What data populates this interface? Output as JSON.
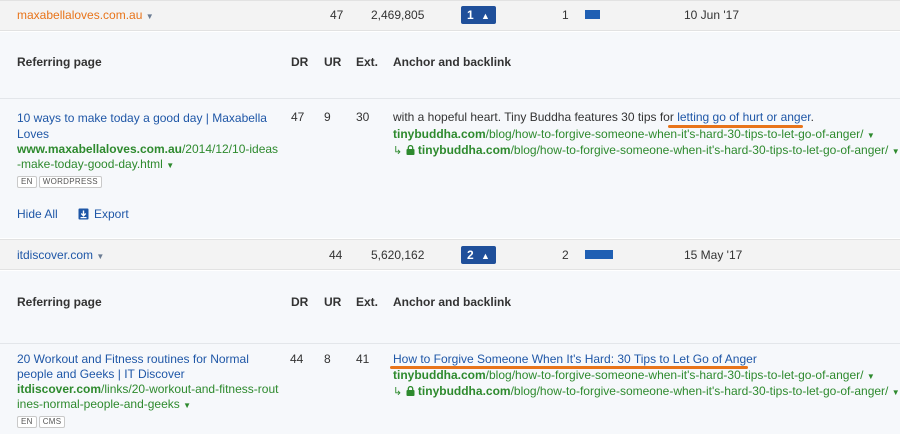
{
  "columns": {
    "referring_page": "Referring page",
    "dr": "DR",
    "ur": "UR",
    "ext": "Ext.",
    "anchor": "Anchor and backlink"
  },
  "groups": [
    {
      "domain": "maxabellaloves.com.au",
      "dr": "47",
      "refdomains": "2,469,805",
      "links": "1",
      "count": "1",
      "date": "10 Jun '17",
      "bar_fraction": 0.3,
      "row": {
        "title_line1": "10 ways to make today a good day | Maxabella",
        "title_line2": "Loves",
        "url_bold": "www.maxabellaloves.com.au",
        "url_rest1": "/2014/12/10-ideas",
        "url_rest2": "-make-today-good-day.html",
        "tags": [
          "EN",
          "WORDPRESS"
        ],
        "dr": "47",
        "ur": "9",
        "ext": "30",
        "anchor_text": "with a hopeful heart. Tiny Buddha features 30 tips for ",
        "anchor_link": "letting go of hurt or anger",
        "anchor_end": ".",
        "backlink_bold": "tinybuddha.com",
        "backlink_rest": "/blog/how-to-forgive-someone-when-it's-hard-30-tips-to-let-go-of-anger/",
        "redirect_bold": "tinybuddha.com",
        "redirect_rest": "/blog/how-to-forgive-someone-when-it's-hard-30-tips-to-let-go-of-anger/"
      }
    },
    {
      "domain": "itdiscover.com",
      "dr": "44",
      "refdomains": "5,620,162",
      "links": "2",
      "count": "2",
      "date": "15 May '17",
      "bar_fraction": 0.65,
      "row": {
        "title_line1": "20 Workout and Fitness routines for Normal",
        "title_line2": "people and Geeks | IT Discover",
        "url_bold": "itdiscover.com",
        "url_rest1": "/links/20-workout-and-fitness-rout",
        "url_rest2": "ines-normal-people-and-geeks",
        "tags": [
          "EN",
          "CMS"
        ],
        "dr": "44",
        "ur": "8",
        "ext": "41",
        "anchor_link": "How to Forgive Someone When It's Hard: 30 Tips to Let Go of Anger",
        "backlink_bold": "tinybuddha.com",
        "backlink_rest": "/blog/how-to-forgive-someone-when-it's-hard-30-tips-to-let-go-of-anger/",
        "redirect_bold": "tinybuddha.com",
        "redirect_rest": "/blog/how-to-forgive-someone-when-it's-hard-30-tips-to-let-go-of-anger/"
      }
    }
  ],
  "actions": {
    "hide_all": "Hide All",
    "export": "Export"
  },
  "colors": {
    "accent_orange": "#e8741a",
    "link_blue": "#1f57a7",
    "url_green": "#2e8a2e",
    "badge_blue": "#1f4f9a"
  }
}
